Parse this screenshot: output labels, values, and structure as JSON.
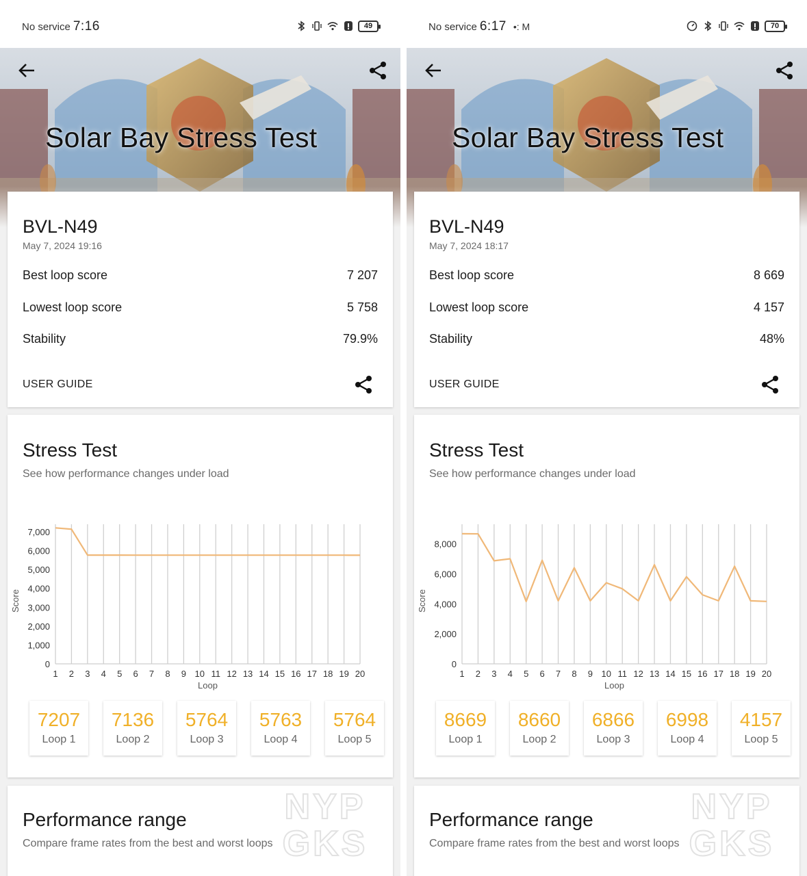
{
  "panels": [
    {
      "status": {
        "carrier": "No service",
        "time": "7:16",
        "extra": "",
        "battery": "49"
      },
      "hero_title": "Solar Bay Stress Test",
      "device": "BVL-N49",
      "date": "May 7, 2024 19:16",
      "metrics": [
        {
          "label": "Best loop score",
          "value": "7 207"
        },
        {
          "label": "Lowest loop score",
          "value": "5 758"
        },
        {
          "label": "Stability",
          "value": "79.9%"
        }
      ],
      "user_guide": "USER GUIDE",
      "stress_title": "Stress Test",
      "stress_subtitle": "See how performance changes under load",
      "loop_cards": [
        {
          "score": "7207",
          "label": "Loop 1"
        },
        {
          "score": "7136",
          "label": "Loop 2"
        },
        {
          "score": "5764",
          "label": "Loop 3"
        },
        {
          "score": "5763",
          "label": "Loop 4"
        },
        {
          "score": "5764",
          "label": "Loop 5"
        }
      ],
      "perf_title": "Performance range",
      "perf_subtitle": "Compare frame rates from the best and worst loops"
    },
    {
      "status": {
        "carrier": "No service",
        "time": "6:17",
        "extra": "•: M",
        "battery": "70"
      },
      "hero_title": "Solar Bay Stress Test",
      "device": "BVL-N49",
      "date": "May 7, 2024 18:17",
      "metrics": [
        {
          "label": "Best loop score",
          "value": "8 669"
        },
        {
          "label": "Lowest loop score",
          "value": "4 157"
        },
        {
          "label": "Stability",
          "value": "48%"
        }
      ],
      "user_guide": "USER GUIDE",
      "stress_title": "Stress Test",
      "stress_subtitle": "See how performance changes under load",
      "loop_cards": [
        {
          "score": "8669",
          "label": "Loop 1"
        },
        {
          "score": "8660",
          "label": "Loop 2"
        },
        {
          "score": "6866",
          "label": "Loop 3"
        },
        {
          "score": "6998",
          "label": "Loop 4"
        },
        {
          "score": "4157",
          "label": "Loop 5"
        }
      ],
      "perf_title": "Performance range",
      "perf_subtitle": "Compare frame rates from the best and worst loops"
    }
  ],
  "watermark": "NYPGKS",
  "colors": {
    "accent": "#f0b028",
    "line": "#f0b878",
    "grid": "#cfcfcf",
    "text": "#1c1c1c",
    "subtext": "#6a6a6a"
  },
  "chart_data": [
    {
      "type": "line",
      "title": "",
      "xlabel": "Loop",
      "ylabel": "Score",
      "x": [
        1,
        2,
        3,
        4,
        5,
        6,
        7,
        8,
        9,
        10,
        11,
        12,
        13,
        14,
        15,
        16,
        17,
        18,
        19,
        20
      ],
      "y": [
        7207,
        7136,
        5764,
        5763,
        5764,
        5760,
        5760,
        5760,
        5760,
        5760,
        5760,
        5760,
        5760,
        5760,
        5760,
        5760,
        5760,
        5760,
        5760,
        5758
      ],
      "yticks": [
        0,
        1000,
        2000,
        3000,
        4000,
        5000,
        6000,
        7000
      ],
      "ytick_labels": [
        "0",
        "1,000",
        "2,000",
        "3,000",
        "4,000",
        "5,000",
        "6,000",
        "7,000"
      ],
      "ylim": [
        0,
        7400
      ],
      "grid": "vertical"
    },
    {
      "type": "line",
      "title": "",
      "xlabel": "Loop",
      "ylabel": "Score",
      "x": [
        1,
        2,
        3,
        4,
        5,
        6,
        7,
        8,
        9,
        10,
        11,
        12,
        13,
        14,
        15,
        16,
        17,
        18,
        19,
        20
      ],
      "y": [
        8669,
        8660,
        6866,
        6998,
        4157,
        6900,
        4200,
        6400,
        4200,
        5400,
        5000,
        4200,
        6600,
        4200,
        5800,
        4600,
        4200,
        6500,
        4200,
        4157
      ],
      "yticks": [
        0,
        2000,
        4000,
        6000,
        8000
      ],
      "ytick_labels": [
        "0",
        "2,000",
        "4,000",
        "6,000",
        "8,000"
      ],
      "ylim": [
        0,
        9300
      ],
      "grid": "vertical"
    }
  ]
}
